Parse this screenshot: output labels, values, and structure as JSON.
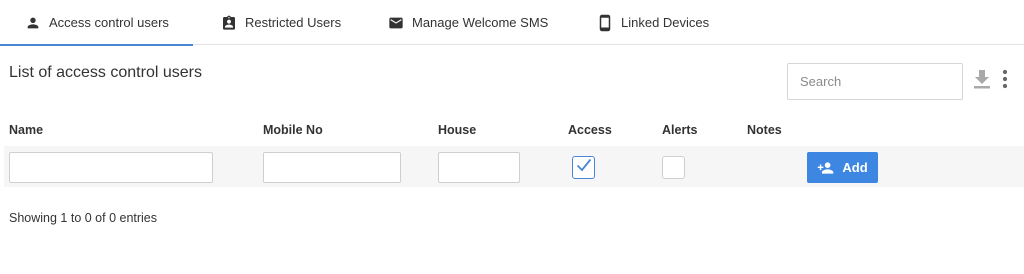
{
  "tabs": [
    {
      "label": "Access control users",
      "icon": "person-icon",
      "active": true
    },
    {
      "label": "Restricted Users",
      "icon": "badge-icon",
      "active": false
    },
    {
      "label": "Manage Welcome SMS",
      "icon": "mail-icon",
      "active": false
    },
    {
      "label": "Linked Devices",
      "icon": "phone-icon",
      "active": false
    }
  ],
  "page": {
    "title": "List of access control users"
  },
  "search": {
    "placeholder": "Search",
    "value": ""
  },
  "toolbar": {
    "download_icon": "download-icon",
    "more_icon": "more-vert-icon"
  },
  "table": {
    "columns": [
      "Name",
      "Mobile No",
      "House",
      "Access",
      "Alerts",
      "Notes"
    ],
    "new_row": {
      "name": "",
      "mobile": "",
      "house": "",
      "access": true,
      "alerts": false,
      "add_label": "Add",
      "add_icon": "person-add-icon"
    }
  },
  "footer": {
    "info": "Showing 1 to 0 of 0 entries"
  },
  "colors": {
    "accent": "#3d86e2",
    "tab_underline": "#4a86d6"
  }
}
